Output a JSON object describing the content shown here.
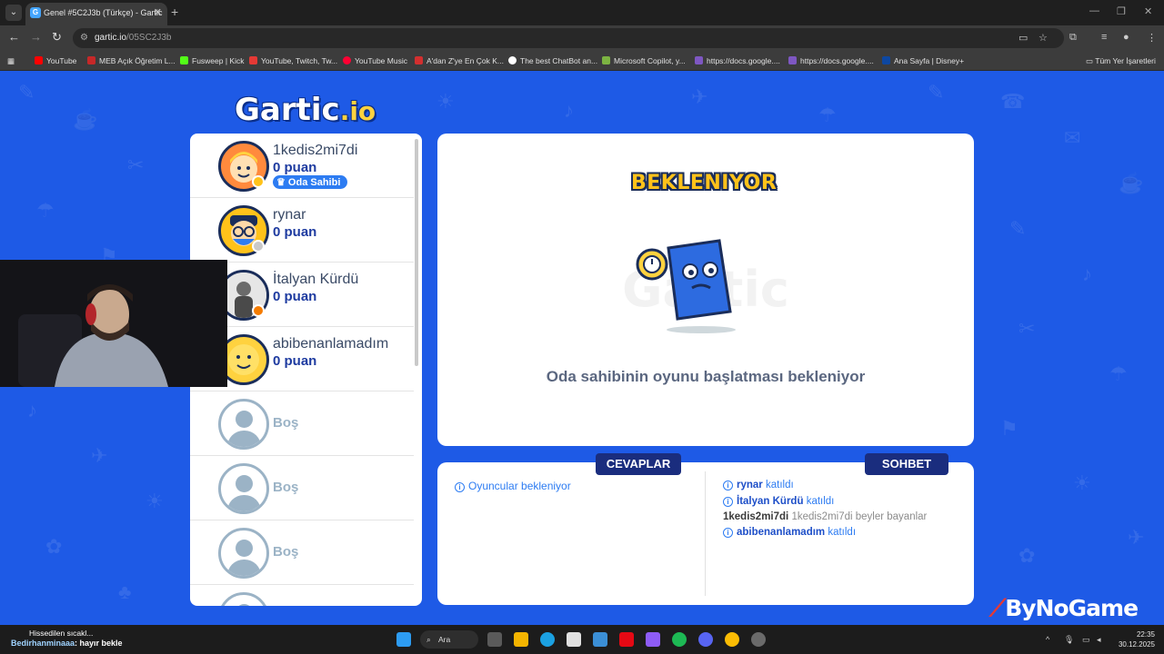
{
  "browser": {
    "tab_title": "Genel #5C2J3b (Türkçe) - Gartic",
    "url_host": "gartic.io",
    "url_path": "/05SC2J3b",
    "bookmarks": [
      {
        "label": "YouTube",
        "color": "#ff0000"
      },
      {
        "label": "MEB Açık Öğretim L...",
        "color": "#c62828"
      },
      {
        "label": "Fusweep | Kick",
        "color": "#53fc18"
      },
      {
        "label": "YouTube, Twitch, Tw...",
        "color": "#e53935"
      },
      {
        "label": "YouTube Music",
        "color": "#ff0033"
      },
      {
        "label": "A'dan Z'ye En Çok K...",
        "color": "#d32f2f"
      },
      {
        "label": "The best ChatBot an...",
        "color": "#ffffff"
      },
      {
        "label": "Microsoft Copilot, y...",
        "color": "#7cb342"
      },
      {
        "label": "https://docs.google....",
        "color": "#7e57c2"
      },
      {
        "label": "https://docs.google....",
        "color": "#7e57c2"
      },
      {
        "label": "Ana Sayfa | Disney+",
        "color": "#0d47a1"
      }
    ],
    "all_bookmarks": "Tüm Yer İşaretleri"
  },
  "game": {
    "logo_main": "Gartic",
    "logo_suffix": ".io",
    "players": [
      {
        "name": "1kedis2mi7di",
        "score": "0 puan",
        "badge": "Oda Sahibi",
        "status_color": "#ffc21a",
        "avatar_bg": "#ff8a3d"
      },
      {
        "name": "rynar",
        "score": "0 puan",
        "badge": "",
        "status_color": "#c9c9c9",
        "avatar_bg": "#ffc21a"
      },
      {
        "name": "İtalyan Kürdü",
        "score": "0 puan",
        "badge": "",
        "status_color": "#f57c00",
        "avatar_bg": "#d9d9d9"
      },
      {
        "name": "abibenanlamadım",
        "score": "0 puan",
        "badge": "",
        "status_color": "",
        "avatar_bg": "#ffd23f"
      }
    ],
    "empty_slot_label": "Boş",
    "waiting_title": "BEKLENIYOR",
    "waiting_message": "Oda sahibinin oyunu başlatması bekleniyor",
    "answers_tab": "CEVAPLAR",
    "chat_tab": "SOHBET",
    "answers_status": "Oyuncular bekleniyor",
    "chat": [
      {
        "type": "join",
        "user": "rynar",
        "text": "katıldı"
      },
      {
        "type": "join",
        "user": "İtalyan Kürdü",
        "text": "katıldı"
      },
      {
        "type": "message",
        "user": "1kedis2mi7di",
        "text": "1kedis2mi7di beyler bayanlar"
      },
      {
        "type": "join",
        "user": "abibenanlamadım",
        "text": "katıldı"
      }
    ]
  },
  "overlay": {
    "watermark": "ByNoGame",
    "notif_title": "Hissedilen sıcakl...",
    "notif_user": "Bedirhanminaaa",
    "notif_text": ": hayır bekle"
  },
  "taskbar": {
    "search_label": "Ara",
    "time": "22:35",
    "date": "30.12.2025"
  }
}
